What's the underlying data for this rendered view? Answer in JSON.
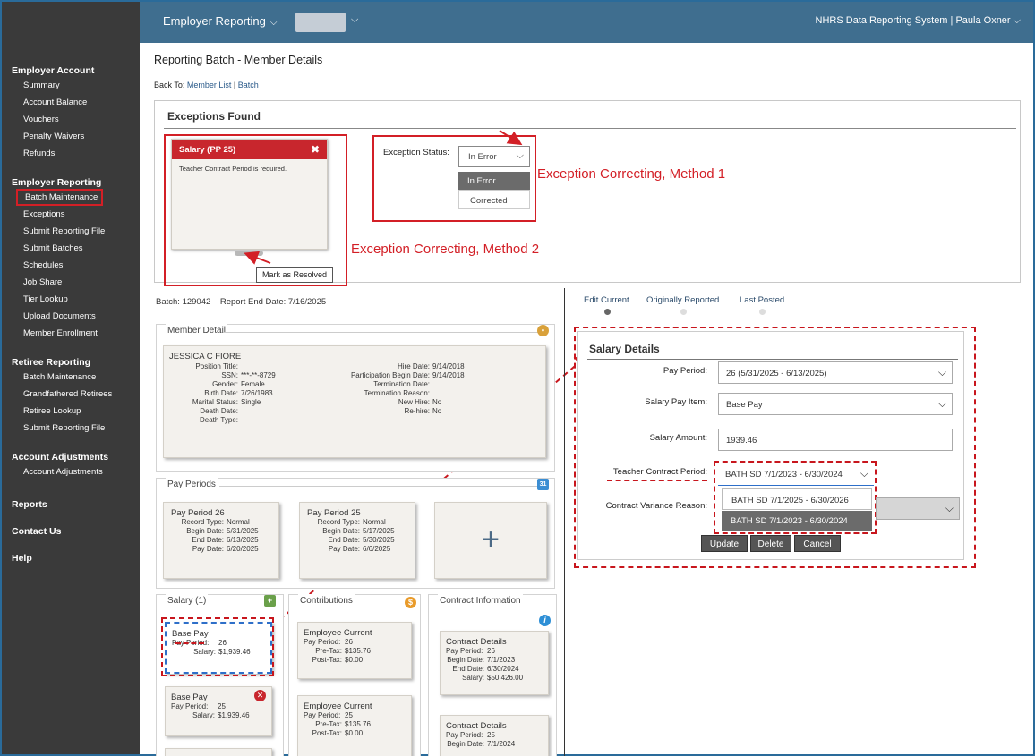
{
  "topbar": {
    "menu": "Employer Reporting",
    "right": "NHRS Data Reporting System  |  Paula Oxner"
  },
  "sidebar": {
    "sections": [
      {
        "title": "Employer Account",
        "items": [
          "Summary",
          "Account Balance",
          "Vouchers",
          "Penalty Waivers",
          "Refunds"
        ]
      },
      {
        "title": "Employer Reporting",
        "items": [
          "Batch Maintenance",
          "Exceptions",
          "Submit Reporting File",
          "Submit Batches",
          "Schedules",
          "Job Share",
          "Tier Lookup",
          "Upload Documents",
          "Member Enrollment"
        ]
      },
      {
        "title": "Retiree Reporting",
        "items": [
          "Batch Maintenance",
          "Grandfathered Retirees",
          "Retiree Lookup",
          "Submit Reporting File"
        ]
      },
      {
        "title": "Account Adjustments",
        "items": [
          "Account Adjustments"
        ]
      },
      {
        "title": "Reports",
        "items": []
      },
      {
        "title": "Contact Us",
        "items": []
      },
      {
        "title": "Help",
        "items": []
      }
    ]
  },
  "page": {
    "title": "Reporting Batch - Member Details",
    "back_to": "Back To:",
    "back_member_list": "Member List",
    "back_sep": "|",
    "back_batch": "Batch"
  },
  "exceptions": {
    "title": "Exceptions Found",
    "card_title": "Salary (PP 25)",
    "card_close": "✖",
    "card_message": "Teacher Contract Period is required.",
    "tooltip": "Mark as Resolved",
    "status_label": "Exception Status:",
    "status_value": "In Error",
    "options": [
      "In Error",
      "Corrected"
    ],
    "annotation_method1": "Exception Correcting, Method 1",
    "annotation_method2": "Exception Correcting, Method 2"
  },
  "batch": {
    "batch_label": "Batch:",
    "batch_number": "129042",
    "report_end_label": "Report End Date:",
    "report_end_date": "7/16/2025"
  },
  "member": {
    "section_title": "Member Detail",
    "name": "JESSICA C FIORE",
    "left": [
      {
        "k": "Position Title:",
        "v": ""
      },
      {
        "k": "SSN:",
        "v": "***-**-8729"
      },
      {
        "k": "Gender:",
        "v": "Female"
      },
      {
        "k": "Birth Date:",
        "v": "7/26/1983"
      },
      {
        "k": "Marital Status:",
        "v": "Single"
      },
      {
        "k": "Death Date:",
        "v": ""
      },
      {
        "k": "Death Type:",
        "v": ""
      }
    ],
    "right": [
      {
        "k": "Hire Date:",
        "v": "9/14/2018"
      },
      {
        "k": "Participation Begin Date:",
        "v": "9/14/2018"
      },
      {
        "k": "Termination Date:",
        "v": ""
      },
      {
        "k": "Termination Reason:",
        "v": ""
      },
      {
        "k": "New Hire:",
        "v": "No"
      },
      {
        "k": "Re-hire:",
        "v": "No"
      }
    ]
  },
  "pay_periods": {
    "section_title": "Pay Periods",
    "cards": [
      {
        "title": "Pay Period 26",
        "rows": [
          {
            "k": "Record Type:",
            "v": "Normal"
          },
          {
            "k": "Begin Date:",
            "v": "5/31/2025"
          },
          {
            "k": "End Date:",
            "v": "6/13/2025"
          },
          {
            "k": "Pay Date:",
            "v": "6/20/2025"
          }
        ]
      },
      {
        "title": "Pay Period 25",
        "rows": [
          {
            "k": "Record Type:",
            "v": "Normal"
          },
          {
            "k": "Begin Date:",
            "v": "5/17/2025"
          },
          {
            "k": "End Date:",
            "v": "5/30/2025"
          },
          {
            "k": "Pay Date:",
            "v": "6/6/2025"
          }
        ]
      }
    ],
    "add": "+"
  },
  "salary": {
    "section_title": "Salary (1)",
    "cards": [
      {
        "title": "Base Pay",
        "rows": [
          {
            "k": "Pay Period:",
            "v": "26"
          },
          {
            "k": "Salary:",
            "v": "$1,939.46"
          }
        ]
      },
      {
        "title": "Base Pay",
        "rows": [
          {
            "k": "Pay Period:",
            "v": "25"
          },
          {
            "k": "Salary:",
            "v": "$1,939.46"
          }
        ]
      }
    ]
  },
  "contributions": {
    "section_title": "Contributions",
    "icon": "$",
    "cards": [
      {
        "title": "Employee Current",
        "rows": [
          {
            "k": "Pay Period:",
            "v": "26"
          },
          {
            "k": "Pre-Tax:",
            "v": "$135.76"
          },
          {
            "k": "Post-Tax:",
            "v": "$0.00"
          }
        ]
      },
      {
        "title": "Employee Current",
        "rows": [
          {
            "k": "Pay Period:",
            "v": "25"
          },
          {
            "k": "Pre-Tax:",
            "v": "$135.76"
          },
          {
            "k": "Post-Tax:",
            "v": "$0.00"
          }
        ]
      }
    ]
  },
  "contract": {
    "section_title": "Contract Information",
    "icon": "i",
    "cards": [
      {
        "title": "Contract Details",
        "rows": [
          {
            "k": "Pay Period:",
            "v": "26"
          },
          {
            "k": "Begin Date:",
            "v": "7/1/2023"
          },
          {
            "k": "End Date:",
            "v": "6/30/2024"
          },
          {
            "k": "Salary:",
            "v": "$50,426.00"
          }
        ]
      },
      {
        "title": "Contract Details",
        "rows": [
          {
            "k": "Pay Period:",
            "v": "25"
          },
          {
            "k": "Begin Date:",
            "v": "7/1/2024"
          }
        ]
      }
    ]
  },
  "tabs": [
    "Edit Current",
    "Originally Reported",
    "Last Posted"
  ],
  "salary_details": {
    "title": "Salary Details",
    "pay_period_label": "Pay Period:",
    "pay_period_value": "26 (5/31/2025 - 6/13/2025)",
    "pay_item_label": "Salary Pay Item:",
    "pay_item_value": "Base Pay",
    "amount_label": "Salary Amount:",
    "amount_value": "1939.46",
    "tcp_label": "Teacher Contract Period:",
    "tcp_value": "BATH SD 7/1/2023 - 6/30/2024",
    "tcp_options": [
      "BATH SD 7/1/2025 - 6/30/2026",
      "BATH SD 7/1/2023 - 6/30/2024"
    ],
    "variance_label": "Contract Variance Reason:",
    "buttons": [
      "Update",
      "Delete",
      "Cancel"
    ]
  },
  "colors": {
    "topbar": "#3f6e8f",
    "sidebar": "#3a3a3a",
    "annotation": "#d31f26",
    "error_header": "#c8262d"
  }
}
